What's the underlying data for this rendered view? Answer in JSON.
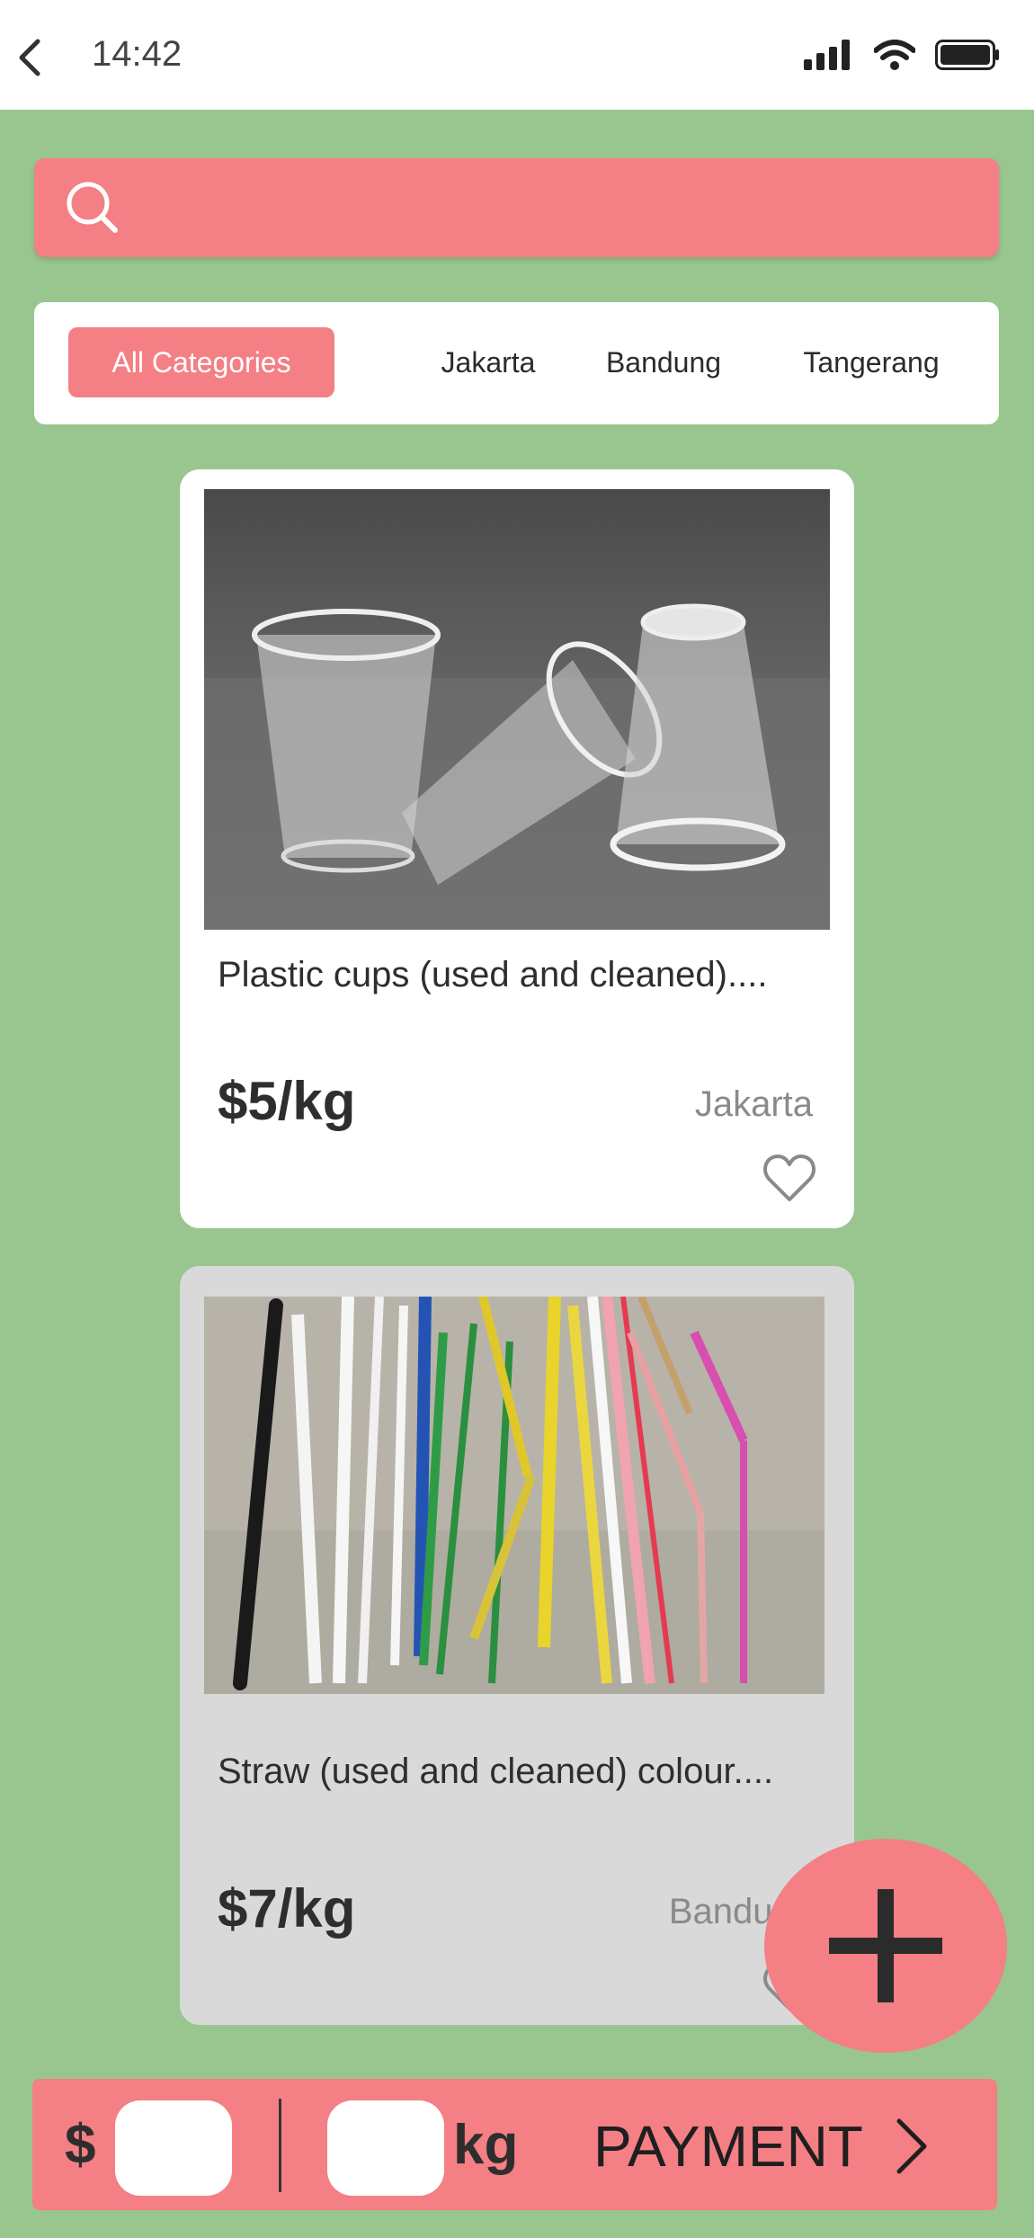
{
  "status_bar": {
    "time": "14:42"
  },
  "search": {
    "placeholder": ""
  },
  "categories": [
    "All Categories",
    "Jakarta",
    "Bandung",
    "Tangerang"
  ],
  "products": [
    {
      "title": "Plastic cups (used and cleaned)....",
      "price": "$5/kg",
      "city": "Jakarta",
      "image_icon": "plastic-cups-photo"
    },
    {
      "title": "Straw (used and cleaned) colour....",
      "price": "$7/kg",
      "city": "Bandung",
      "image_icon": "straws-photo"
    }
  ],
  "bottom_bar": {
    "currency": "$",
    "unit": "kg",
    "payment_label": "PAYMENT"
  },
  "colors": {
    "background": "#99c68e",
    "accent": "#f47f84",
    "card_selected": "#ffffff",
    "card_other": "#d9d9d9"
  }
}
